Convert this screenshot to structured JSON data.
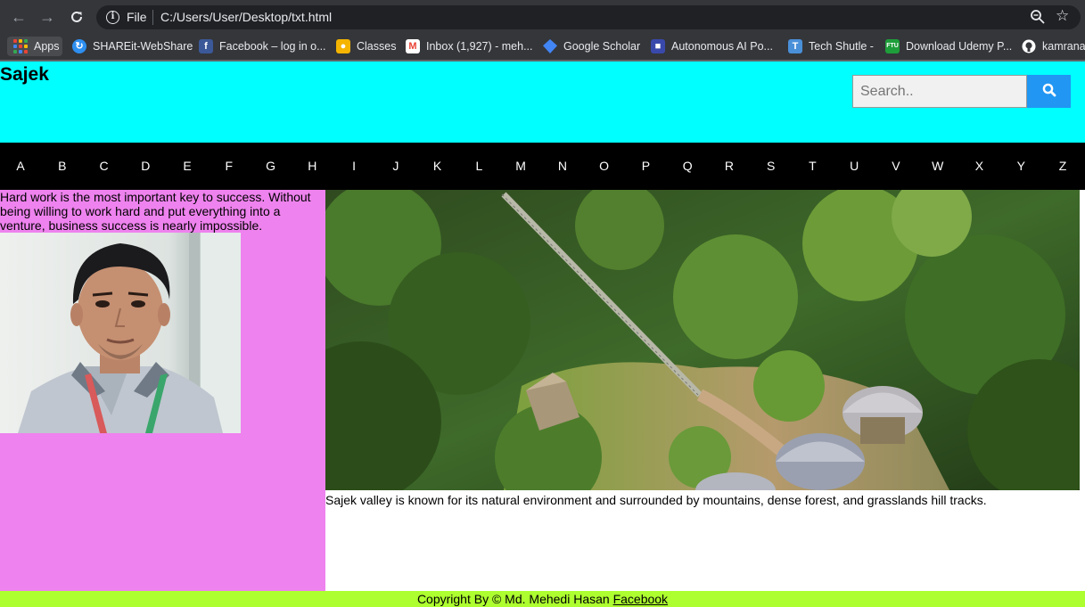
{
  "browser": {
    "omnibox": {
      "scheme_label": "File",
      "url": "C:/Users/User/Desktop/txt.html"
    },
    "icons": [
      "back-icon",
      "forward-icon",
      "reload-icon",
      "info-icon",
      "zoom-icon",
      "star-icon"
    ],
    "bookmarks": [
      {
        "label": "Apps",
        "icon": "apps-grid-icon"
      },
      {
        "label": "SHAREit-WebShare",
        "icon": "shareit-icon",
        "color": "#2d8ff0"
      },
      {
        "label": "Facebook – log in o...",
        "icon": "facebook-icon",
        "color": "#3b5998"
      },
      {
        "label": "Classes",
        "icon": "classroom-icon",
        "color": "#f4b400"
      },
      {
        "label": "Inbox (1,927) - meh...",
        "icon": "gmail-icon",
        "color": "#ea4335"
      },
      {
        "label": "Google Scholar",
        "icon": "scholar-icon",
        "color": "#4285f4"
      },
      {
        "label": "Autonomous AI Po...",
        "icon": "autonomous-icon",
        "color": "#3949ab"
      },
      {
        "label": "Tech Shutle -",
        "icon": "techshutle-icon",
        "color": "#4a90d9"
      },
      {
        "label": "Download Udemy P...",
        "icon": "ftu-icon",
        "color": "#1e9e3a"
      },
      {
        "label": "kamrana",
        "icon": "github-icon",
        "color": "#ffffff"
      }
    ]
  },
  "site": {
    "title": "Sajek",
    "search": {
      "placeholder": "Search.."
    },
    "letters": [
      "A",
      "B",
      "C",
      "D",
      "E",
      "F",
      "G",
      "H",
      "I",
      "J",
      "K",
      "L",
      "M",
      "N",
      "O",
      "P",
      "Q",
      "R",
      "S",
      "T",
      "U",
      "V",
      "W",
      "X",
      "Y",
      "Z"
    ],
    "quote": "Hard work is the most important key to success. Without being willing to work hard and put everything into a venture, business success is nearly impossible.",
    "caption": "Sajek valley is known for its natural environment and surrounded by mountains, dense forest, and grasslands hill tracks.",
    "footer": {
      "text": "Copyright By © Md. Mehedi Hasan",
      "link": "Facebook"
    },
    "colors": {
      "header": "#00ffff",
      "nav": "#000000",
      "sidebar": "#ee82ee",
      "footer": "#adff2f",
      "search_button": "#2196f3"
    }
  }
}
